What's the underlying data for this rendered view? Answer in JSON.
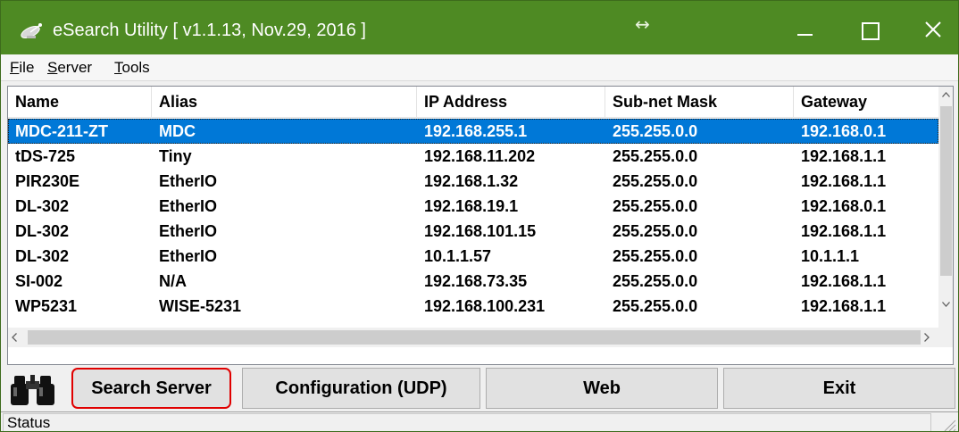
{
  "window": {
    "title": "eSearch Utility [ v1.1.13, Nov.29, 2016 ]",
    "title_bar_color": "#4e8a23",
    "resize_glyph": "↔"
  },
  "menu": {
    "items": [
      "File",
      "Server",
      "Tools"
    ]
  },
  "table": {
    "columns": [
      "Name",
      "Alias",
      "IP Address",
      "Sub-net Mask",
      "Gateway"
    ],
    "selected_index": 0,
    "rows": [
      [
        "MDC-211-ZT",
        "MDC",
        "192.168.255.1",
        "255.255.0.0",
        "192.168.0.1"
      ],
      [
        "tDS-725",
        "Tiny",
        "192.168.11.202",
        "255.255.0.0",
        "192.168.1.1"
      ],
      [
        "PIR230E",
        "EtherIO",
        "192.168.1.32",
        "255.255.0.0",
        "192.168.1.1"
      ],
      [
        "DL-302",
        "EtherIO",
        "192.168.19.1",
        "255.255.0.0",
        "192.168.0.1"
      ],
      [
        "DL-302",
        "EtherIO",
        "192.168.101.15",
        "255.255.0.0",
        "192.168.1.1"
      ],
      [
        "DL-302",
        "EtherIO",
        "10.1.1.57",
        "255.255.0.0",
        "10.1.1.1"
      ],
      [
        "SI-002",
        "N/A",
        "192.168.73.35",
        "255.255.0.0",
        "192.168.1.1"
      ],
      [
        "WP5231",
        "WISE-5231",
        "192.168.100.231",
        "255.255.0.0",
        "192.168.1.1"
      ]
    ]
  },
  "buttons": {
    "search": "Search Server",
    "config": "Configuration (UDP)",
    "web": "Web",
    "exit": "Exit"
  },
  "status": {
    "text": "Status"
  },
  "icons": {
    "app": "satellite-dish-icon",
    "search": "binoculars-icon"
  },
  "colors": {
    "selection": "#0078d7",
    "highlight_border": "#e00000"
  }
}
